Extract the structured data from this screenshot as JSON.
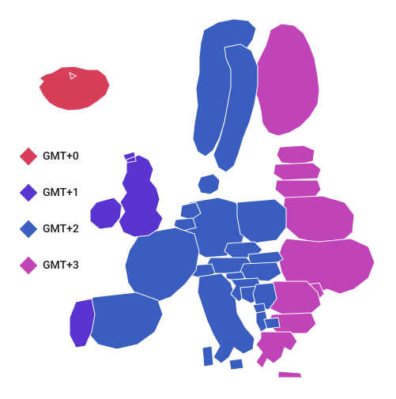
{
  "legend": {
    "items": [
      {
        "label": "GMT+0",
        "color": "#D83E5A"
      },
      {
        "label": "GMT+1",
        "color": "#5B33D1"
      },
      {
        "label": "GMT+2",
        "color": "#3A5DC0"
      },
      {
        "label": "GMT+3",
        "color": "#C143B8"
      }
    ]
  },
  "colors": {
    "gmt0": "#D83E5A",
    "gmt1": "#5B33D1",
    "gmt2": "#3A5DC0",
    "gmt3": "#C143B8",
    "border": "#FFFFFF"
  },
  "chart_data": {
    "type": "choropleth-map",
    "title": "",
    "region": "Europe",
    "variable": "time_zone_offset_gmt",
    "categories": [
      "GMT+0",
      "GMT+1",
      "GMT+2",
      "GMT+3"
    ],
    "series": [
      {
        "name": "GMT+0",
        "color": "#D83E5A",
        "members": [
          "Iceland"
        ]
      },
      {
        "name": "GMT+1",
        "color": "#5B33D1",
        "members": [
          "Ireland",
          "United Kingdom",
          "Portugal"
        ]
      },
      {
        "name": "GMT+2",
        "color": "#3A5DC0",
        "members": [
          "Spain",
          "France",
          "Belgium",
          "Netherlands",
          "Luxembourg",
          "Germany",
          "Switzerland",
          "Italy",
          "Austria",
          "Czechia",
          "Poland",
          "Denmark",
          "Norway",
          "Sweden",
          "Slovenia",
          "Croatia",
          "Bosnia",
          "Serbia",
          "Hungary",
          "Slovakia",
          "Albania",
          "North Macedonia",
          "Montenegro",
          "Malta"
        ]
      },
      {
        "name": "GMT+3",
        "color": "#C143B8",
        "members": [
          "Finland",
          "Estonia",
          "Latvia",
          "Lithuania",
          "Belarus",
          "Ukraine",
          "Moldova",
          "Romania",
          "Bulgaria",
          "Greece",
          "Cyprus"
        ]
      }
    ]
  }
}
